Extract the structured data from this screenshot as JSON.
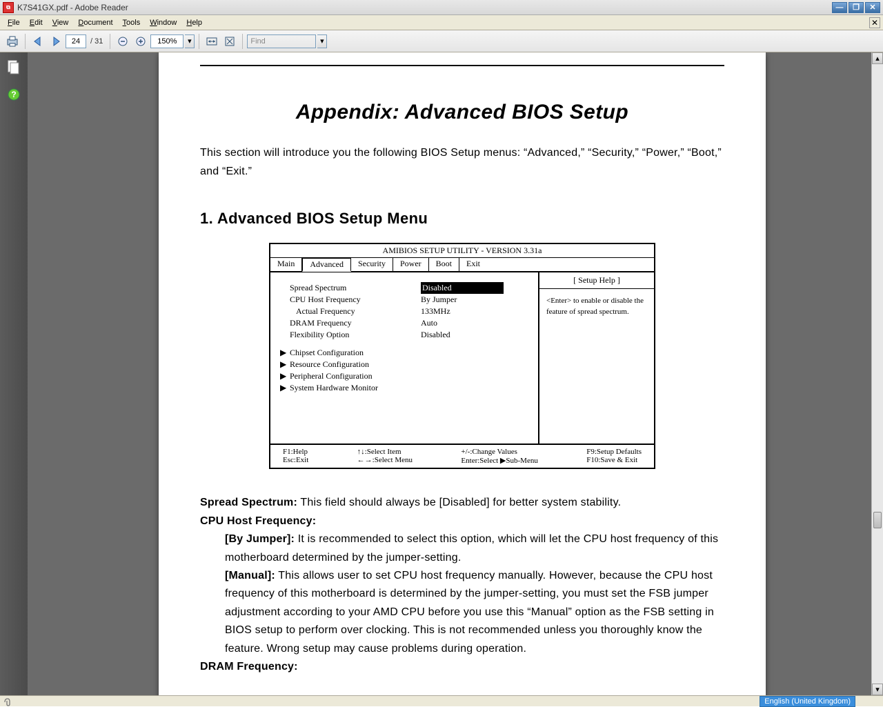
{
  "window": {
    "title": "K7S41GX.pdf - Adobe Reader"
  },
  "menu": {
    "file": "File",
    "edit": "Edit",
    "view": "View",
    "document": "Document",
    "tools": "Tools",
    "window": "Window",
    "help": "Help"
  },
  "toolbar": {
    "page_current": "24",
    "page_total": "/ 31",
    "zoom": "150%",
    "find_placeholder": "Find"
  },
  "status": {
    "language": "English (United Kingdom)"
  },
  "doc": {
    "heading": "Appendix: Advanced BIOS Setup",
    "intro": "This section will introduce you the following BIOS Setup menus: “Advanced,” “Security,” “Power,” “Boot,” and “Exit.”",
    "section1": "1. Advanced BIOS Setup Menu",
    "bios": {
      "title": "AMIBIOS SETUP UTILITY - VERSION 3.31a",
      "tabs": [
        "Main",
        "Advanced",
        "Security",
        "Power",
        "Boot",
        "Exit"
      ],
      "rows": [
        {
          "label": "Spread Spectrum",
          "value": "Disabled",
          "hl": true
        },
        {
          "label": "CPU Host Frequency",
          "value": "By Jumper"
        },
        {
          "label": "   Actual Frequency",
          "value": "133MHz"
        },
        {
          "label": "DRAM Frequency",
          "value": "Auto"
        },
        {
          "label": "Flexibility Option",
          "value": "Disabled"
        }
      ],
      "subs": [
        "Chipset Configuration",
        "Resource Configuration",
        "Peripheral Configuration",
        "System Hardware Monitor"
      ],
      "help_title": "[   Setup Help   ]",
      "help_body": "<Enter> to enable or disable the feature of spread spectrum.",
      "footer": {
        "c1a": "F1:Help",
        "c1b": "Esc:Exit",
        "c2a": "↑↓:Select Item",
        "c2b": "←→:Select Menu",
        "c3a": "+/-:Change Values",
        "c3b": "Enter:Select   ▶Sub-Menu",
        "c4a": "F9:Setup Defaults",
        "c4b": "F10:Save & Exit"
      }
    },
    "body": {
      "ss_label": "Spread Spectrum:",
      "ss_text": " This field should always be [Disabled] for better system stability.",
      "cpu_label": "CPU Host Frequency:",
      "byj_label": "[By Jumper]:",
      "byj_text": " It is recommended to select this option, which will let the CPU host frequency of this motherboard determined by the jumper-setting.",
      "man_label": "[Manual]:",
      "man_text": " This allows user to set CPU host frequency manually. However, because the CPU host frequency of this motherboard is determined by the jumper-setting, you must set the FSB jumper adjustment according to your AMD CPU before you use this “Manual” option as the FSB setting in BIOS setup to perform over clocking. This is not recommended unless you thoroughly know the feature. Wrong setup may cause problems during operation.",
      "dram_label": "DRAM Frequency:"
    }
  }
}
